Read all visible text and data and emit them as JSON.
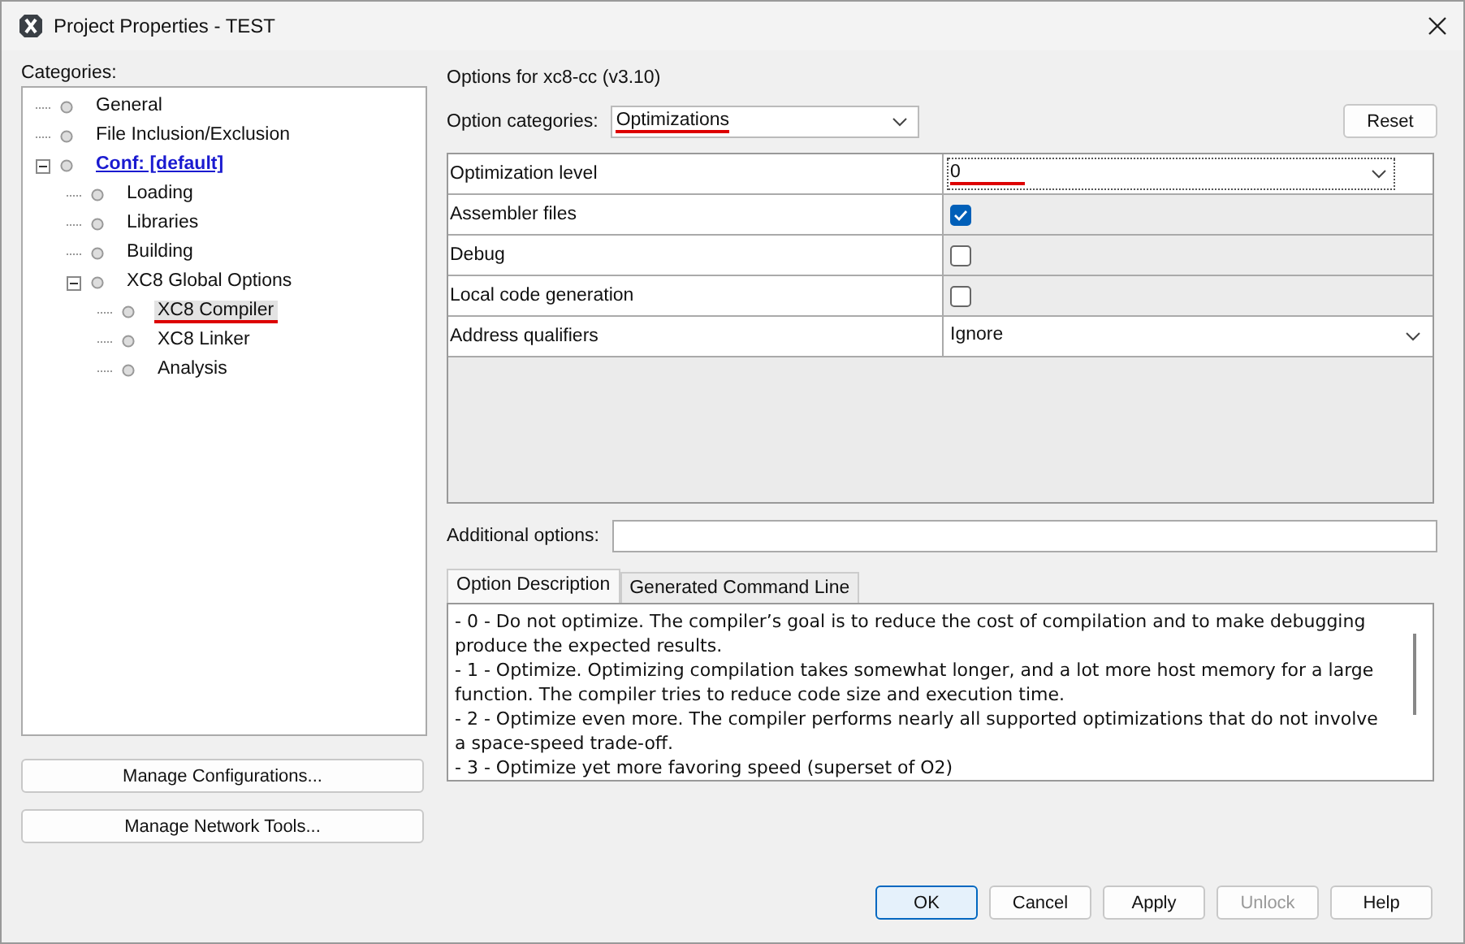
{
  "window": {
    "title": "Project Properties - TEST"
  },
  "categories": {
    "label": "Categories:",
    "items": [
      {
        "label": "General",
        "link": false,
        "selected": false,
        "annotated": false
      },
      {
        "label": "File Inclusion/Exclusion",
        "link": false,
        "selected": false,
        "annotated": false
      },
      {
        "label": "Conf: [default]",
        "link": true,
        "selected": false,
        "annotated": false,
        "expanded": true,
        "children": [
          {
            "label": "Loading",
            "link": false,
            "selected": false,
            "annotated": false
          },
          {
            "label": "Libraries",
            "link": false,
            "selected": false,
            "annotated": false
          },
          {
            "label": "Building",
            "link": false,
            "selected": false,
            "annotated": false
          },
          {
            "label": "XC8 Global Options",
            "link": false,
            "selected": false,
            "annotated": false,
            "expanded": true,
            "children": [
              {
                "label": "XC8 Compiler",
                "link": false,
                "selected": true,
                "annotated": true
              },
              {
                "label": "XC8 Linker",
                "link": false,
                "selected": false,
                "annotated": false
              },
              {
                "label": "Analysis",
                "link": false,
                "selected": false,
                "annotated": false
              }
            ]
          }
        ]
      }
    ]
  },
  "left_buttons": [
    "Manage Configurations...",
    "Manage Network Tools..."
  ],
  "options_title": "Options for xc8-cc (v3.10)",
  "option_categories": {
    "label": "Option categories:",
    "value": "Optimizations",
    "annotated": true
  },
  "reset_button": "Reset",
  "options": [
    {
      "label": "Optimization level",
      "kind": "dropdown",
      "value": "0",
      "focused": true,
      "annotated": true
    },
    {
      "label": "Assembler files",
      "kind": "checkbox",
      "checked": true,
      "annotated": false
    },
    {
      "label": "Debug",
      "kind": "checkbox",
      "checked": false,
      "annotated": false
    },
    {
      "label": "Local code generation",
      "kind": "checkbox",
      "checked": false,
      "annotated": false
    },
    {
      "label": "Address qualifiers",
      "kind": "dropdown",
      "value": "Ignore",
      "focused": false,
      "annotated": false
    }
  ],
  "additional_options": {
    "label": "Additional options:"
  },
  "tabs": [
    {
      "label": "Option Description",
      "selected": true
    },
    {
      "label": "Generated Command Line",
      "selected": false
    }
  ],
  "description": [
    "- 0 - Do not optimize. The compiler’s goal is to reduce the cost of compilation and to make debugging produce the expected results.",
    "- 1 - Optimize. Optimizing compilation takes somewhat longer, and a lot more host memory for a large function. The compiler tries to reduce code size and execution time.",
    "- 2 - Optimize even more. The compiler performs nearly all supported optimizations that do not involve a space-speed trade-off.",
    "- 3 - Optimize yet more favoring speed (superset of O2)"
  ],
  "buttons": [
    {
      "label": "OK",
      "default": true,
      "disabled": false
    },
    {
      "label": "Cancel",
      "default": false,
      "disabled": false
    },
    {
      "label": "Apply",
      "default": false,
      "disabled": false
    },
    {
      "label": "Unlock",
      "default": false,
      "disabled": true
    },
    {
      "label": "Help",
      "default": false,
      "disabled": false
    }
  ]
}
